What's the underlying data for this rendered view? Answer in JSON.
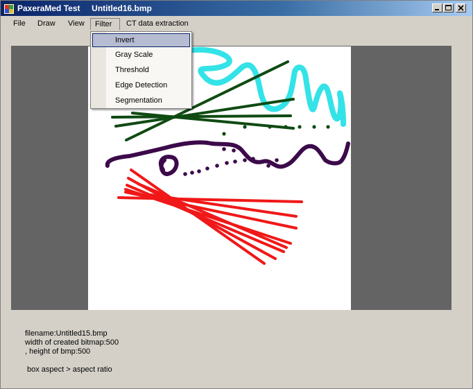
{
  "window": {
    "title": "PaxeraMed Test     Untitled16.bmp",
    "controls": [
      "minimize",
      "maximize",
      "close"
    ]
  },
  "menubar": {
    "items": [
      {
        "label": "File"
      },
      {
        "label": "Draw"
      },
      {
        "label": "View"
      },
      {
        "label": "Filter",
        "active": true
      },
      {
        "label": "CT data extraction"
      }
    ]
  },
  "filter_menu": {
    "items": [
      {
        "label": "Invert",
        "highlighted": true
      },
      {
        "label": "Gray Scale"
      },
      {
        "label": "Threshold"
      },
      {
        "label": "Edge Detection"
      },
      {
        "label": "Segmentation"
      }
    ]
  },
  "canvas": {
    "stroke_colors": {
      "cyan": "#33e3e8",
      "green": "#0f4a12",
      "purple": "#3c0a4a",
      "red": "#f01818"
    }
  },
  "info": {
    "filename": "filename:Untitled15.bmp",
    "width": "width of created bitmap:500",
    "height": ", height of bmp:500",
    "aspect": "box aspect > aspect ratio"
  },
  "colors": {
    "titlebar": "#0a246a",
    "menu_highlight": "#b6bdd2",
    "panel": "#646464"
  }
}
